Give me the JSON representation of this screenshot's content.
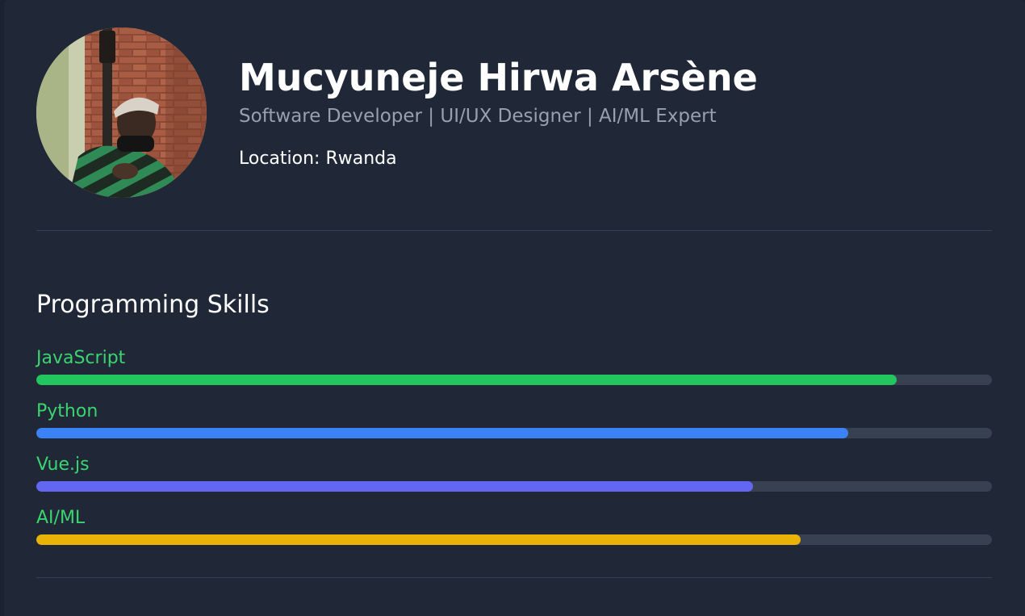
{
  "profile": {
    "name": "Mucyuneje Hirwa Arsène",
    "subtitle": "Software Developer | UI/UX Designer | AI/ML Expert",
    "location": "Location: Rwanda"
  },
  "skills_section": {
    "title": "Programming Skills",
    "skills": [
      {
        "label": "JavaScript",
        "level": 0.9,
        "color": "#22c55e"
      },
      {
        "label": "Python",
        "level": 0.85,
        "color": "#3b82f6"
      },
      {
        "label": "Vue.js",
        "level": 0.75,
        "color": "#6366f1"
      },
      {
        "label": "AI/ML",
        "level": 0.8,
        "color": "#eab308"
      }
    ]
  },
  "colors": {
    "background": "#202838",
    "skill_label": "#3bd46f",
    "track": "#374151"
  }
}
